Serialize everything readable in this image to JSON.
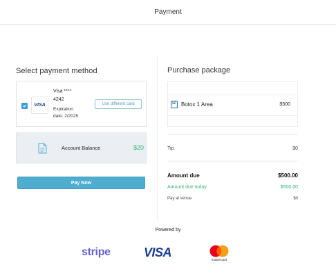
{
  "header": {
    "title": "Payment"
  },
  "left": {
    "heading": "Select payment method",
    "card": {
      "brand": "VISA",
      "line1": "Visa ****",
      "line2": "4242",
      "exp_label": "Expiration",
      "exp_value": "date: 2/2025",
      "use_different_label": "Use different card",
      "selected": true
    },
    "balance": {
      "label": "Account Balance",
      "amount": "$20"
    },
    "pay_button": "Pay Now"
  },
  "right": {
    "heading": "Purchase package",
    "package": {
      "name": "Botox 1 Area",
      "price": "$500"
    },
    "tip": {
      "label": "Tip",
      "value": "$0"
    },
    "amount_due": {
      "label": "Amount due",
      "value": "$500.00"
    },
    "amount_due_today": {
      "label": "Amount due today",
      "value": "$500.00"
    },
    "pay_at_venue": {
      "label": "Pay at venue",
      "value": "$0"
    }
  },
  "footer": {
    "powered_by": "Powered by",
    "stripe": "stripe",
    "visa": "VISA",
    "mastercard": "mastercard"
  },
  "colors": {
    "accent": "#4faecf",
    "green": "#34b27a",
    "checkbox": "#3b9bd6",
    "stripe": "#6461d5",
    "visa": "#1a3c8f"
  }
}
